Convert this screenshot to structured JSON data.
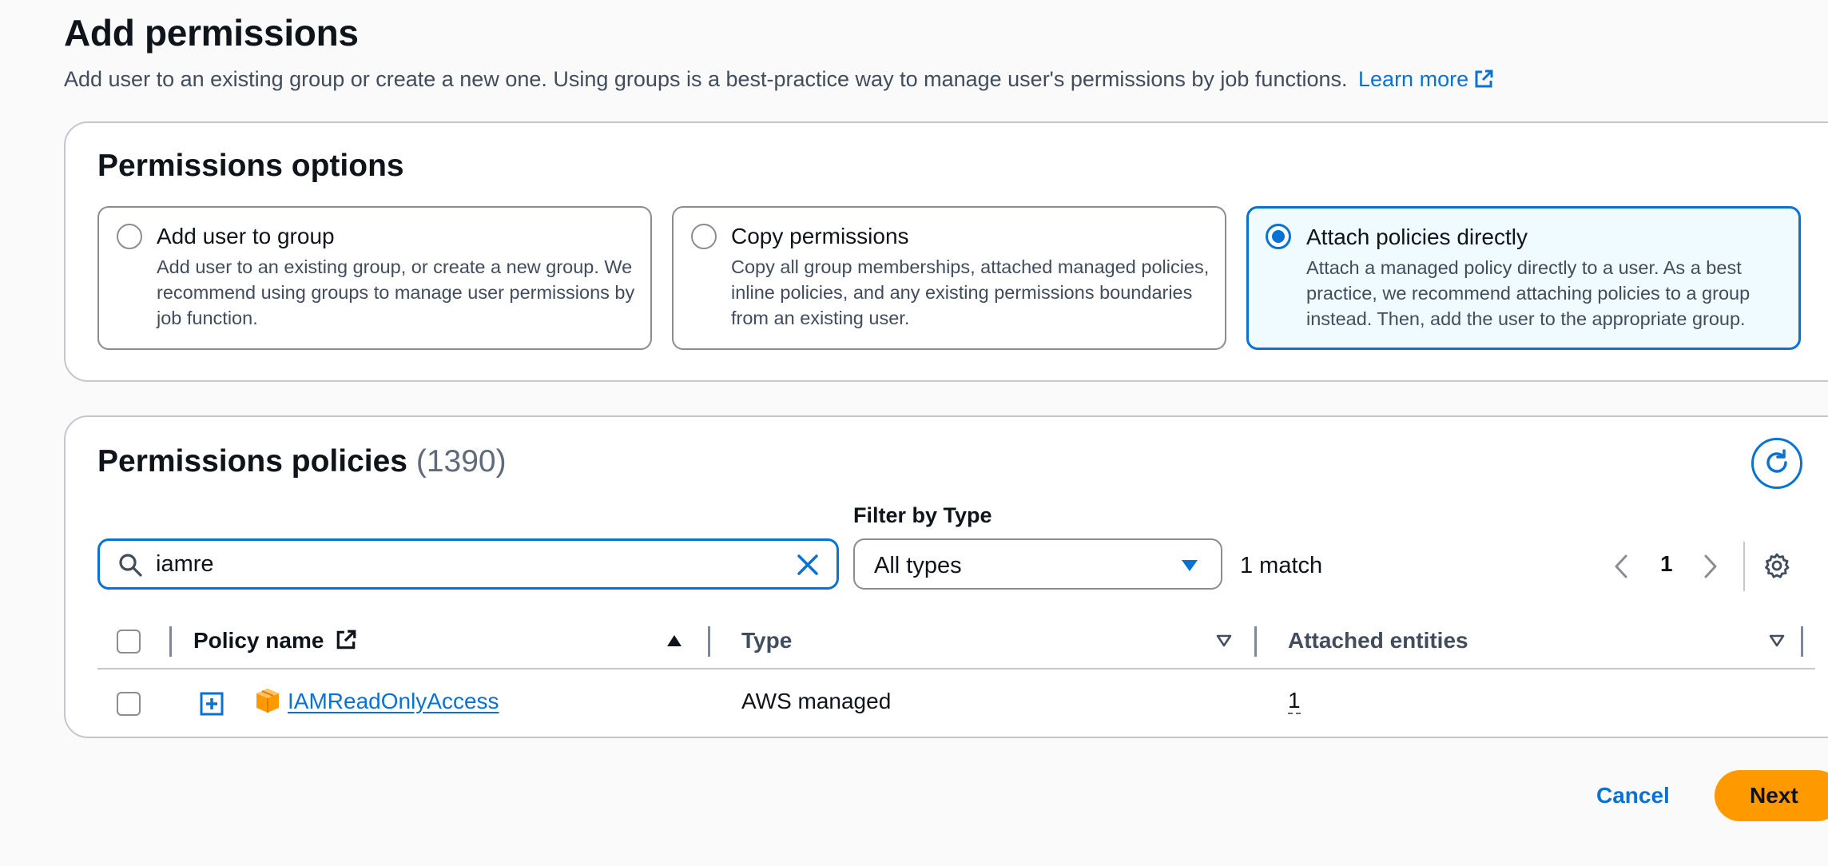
{
  "header": {
    "title": "Add permissions",
    "description": "Add user to an existing group or create a new one. Using groups is a best-practice way to manage user's permissions by job functions.",
    "learn_more": "Learn more"
  },
  "permissions_options": {
    "title": "Permissions options",
    "options": [
      {
        "title": "Add user to group",
        "description": "Add user to an existing group, or create a new group. We recommend using groups to manage user permissions by job function.",
        "selected": false
      },
      {
        "title": "Copy permissions",
        "description": "Copy all group memberships, attached managed policies, inline policies, and any existing permissions boundaries from an existing user.",
        "selected": false
      },
      {
        "title": "Attach policies directly",
        "description": "Attach a managed policy directly to a user. As a best practice, we recommend attaching policies to a group instead. Then, add the user to the appropriate group.",
        "selected": true
      }
    ]
  },
  "permissions_policies": {
    "title": "Permissions policies",
    "count": "(1390)",
    "search": {
      "value": "iamre"
    },
    "filter": {
      "label": "Filter by Type",
      "selected": "All types"
    },
    "match_count": "1 match",
    "page": "1",
    "columns": [
      "Policy name",
      "Type",
      "Attached entities"
    ],
    "rows": [
      {
        "policy_name": "IAMReadOnlyAccess",
        "type": "AWS managed",
        "attached_entities": "1"
      }
    ]
  },
  "footer": {
    "cancel_label": "Cancel",
    "next_label": "Next"
  },
  "colors": {
    "accent": "#0972d3",
    "primary_button": "#ff9900",
    "selected_tile_bg": "#f0fbff"
  }
}
